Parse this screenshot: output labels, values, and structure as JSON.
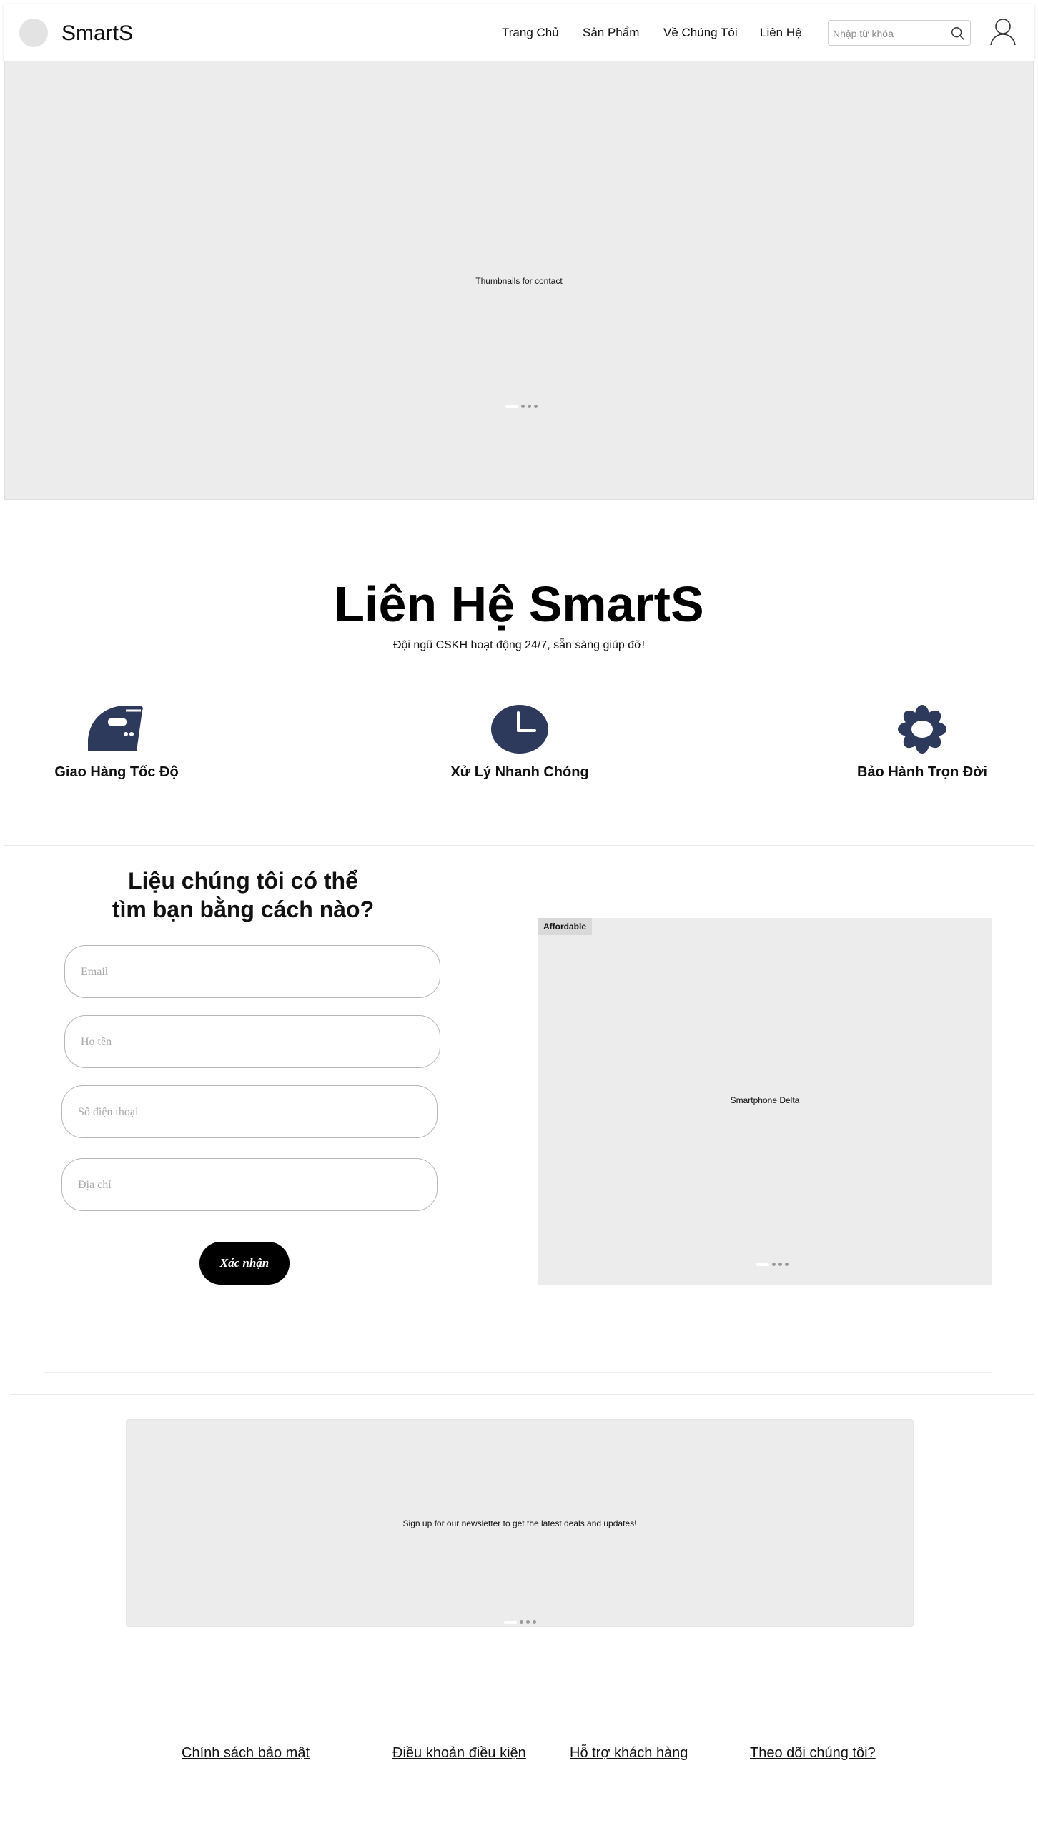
{
  "header": {
    "brand": "SmartS",
    "nav": [
      "Trang Chủ",
      "Sản Phẩm",
      "Về Chúng Tôi",
      "Liên Hệ"
    ],
    "search_placeholder": "Nhập từ khóa"
  },
  "hero": {
    "caption": "Thumbnails for contact"
  },
  "contact": {
    "title": "Liên Hệ SmartS",
    "subtitle": "Đội ngũ CSKH hoạt động 24/7, sẵn sàng giúp đỡ!"
  },
  "features": [
    {
      "icon": "iron-icon",
      "label": "Giao Hàng Tốc Độ"
    },
    {
      "icon": "clock-icon",
      "label": "Xử Lý Nhanh Chóng"
    },
    {
      "icon": "flower-icon",
      "label": "Bảo Hành Trọn Đời"
    }
  ],
  "form": {
    "title_line1": "Liệu chúng tôi có thể",
    "title_line2": "tìm bạn bằng cách nào?",
    "email_placeholder": "Email",
    "name_placeholder": "Họ tên",
    "phone_placeholder": "Số điện thoại",
    "address_placeholder": "Địa chỉ",
    "submit_label": "Xác nhận"
  },
  "product_card": {
    "badge": "Affordable",
    "name": "Smartphone Delta"
  },
  "newsletter": {
    "text": "Sign up for our newsletter to get the latest deals and updates!"
  },
  "footer": {
    "links": [
      "Chính sách bảo mật",
      "Điều khoản điều kiện",
      "Hỗ trợ khách hàng",
      "Theo dõi chúng tôi?"
    ]
  },
  "colors": {
    "icon_navy": "#2e3a5c",
    "placeholder_gray": "#ececec",
    "button_black": "#000000"
  }
}
